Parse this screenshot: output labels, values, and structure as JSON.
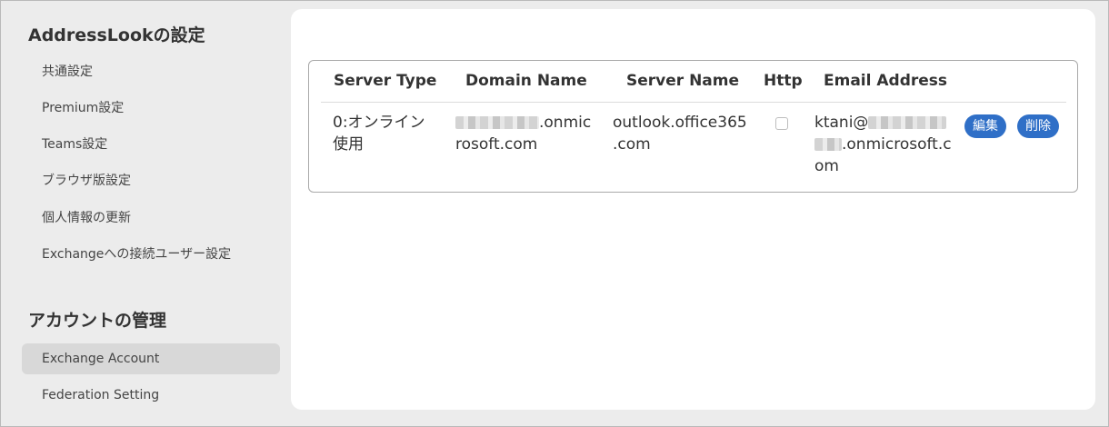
{
  "sidebar": {
    "settings_title": "AddressLookの設定",
    "settings_items": [
      {
        "label": "共通設定"
      },
      {
        "label": "Premium設定"
      },
      {
        "label": "Teams設定"
      },
      {
        "label": "ブラウザ版設定"
      },
      {
        "label": "個人情報の更新"
      },
      {
        "label": "Exchangeへの接続ユーザー設定"
      }
    ],
    "account_title": "アカウントの管理",
    "account_items": [
      {
        "label": "Exchange Account",
        "active": true
      },
      {
        "label": "Federation Setting",
        "active": false
      }
    ]
  },
  "table": {
    "headers": {
      "server_type": "Server Type",
      "domain_name": "Domain Name",
      "server_name": "Server Name",
      "http": "Http",
      "email": "Email Address"
    },
    "row": {
      "server_type_line1": "0:オンライン",
      "server_type_line2": "使用",
      "domain_suffix_line1": ".onmic",
      "domain_line2": "rosoft.com",
      "server_name_line1": "outlook.office365",
      "server_name_line2": ".com",
      "http_checked": false,
      "email_line1_prefix": "ktani@",
      "email_line2_suffix": ".onmicrosoft.c",
      "email_line3": "om",
      "edit_label": "編集",
      "delete_label": "削除"
    }
  },
  "colors": {
    "button": "#2f6fc7",
    "active_nav": "#d8d8d8",
    "background": "#ececec",
    "panel": "#ffffff"
  }
}
